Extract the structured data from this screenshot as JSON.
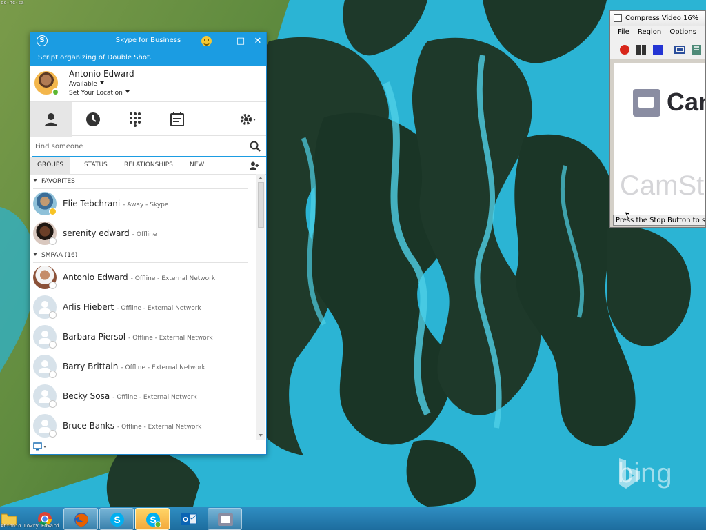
{
  "desktop": {
    "corner_watermark": "cc-nc-sa",
    "brand_watermark": "bing"
  },
  "skype": {
    "title": "Skype for Business",
    "note": "Script organizing of Double Shot.",
    "profile": {
      "name": "Antonio Edward",
      "availability": "Available",
      "location": "Set Your Location"
    },
    "search": {
      "placeholder": "Find someone"
    },
    "filters": [
      "GROUPS",
      "STATUS",
      "RELATIONSHIPS",
      "NEW"
    ],
    "groups": [
      {
        "title": "FAVORITES",
        "contacts": [
          {
            "name": "Elie Tebchrani",
            "status": "- Away - Skype"
          },
          {
            "name": "serenity edward",
            "status": "- Offline"
          }
        ]
      },
      {
        "title": "SMPAA (16)",
        "contacts": [
          {
            "name": "Antonio Edward",
            "status": "- Offline - External Network"
          },
          {
            "name": "Arlis Hiebert",
            "status": "- Offline - External Network"
          },
          {
            "name": "Barbara Piersol",
            "status": "- Offline - External Network"
          },
          {
            "name": "Barry Brittain",
            "status": "- Offline - External Network"
          },
          {
            "name": "Becky Sosa",
            "status": "- Offline - External Network"
          },
          {
            "name": "Bruce Banks",
            "status": "- Offline - External Network"
          }
        ]
      }
    ],
    "colors": {
      "accent": "#1b9ce2",
      "away": "#f7c325",
      "available": "#5cb731"
    }
  },
  "camstudio": {
    "title": "Compress Video 16%",
    "menu": [
      "File",
      "Region",
      "Options",
      "To"
    ],
    "logo_text": "Cam",
    "logo_faint_text": "CamStu",
    "status": "Press the Stop Button to stop"
  },
  "taskbar": {
    "user_label": "Antonio Lowry Edward"
  }
}
